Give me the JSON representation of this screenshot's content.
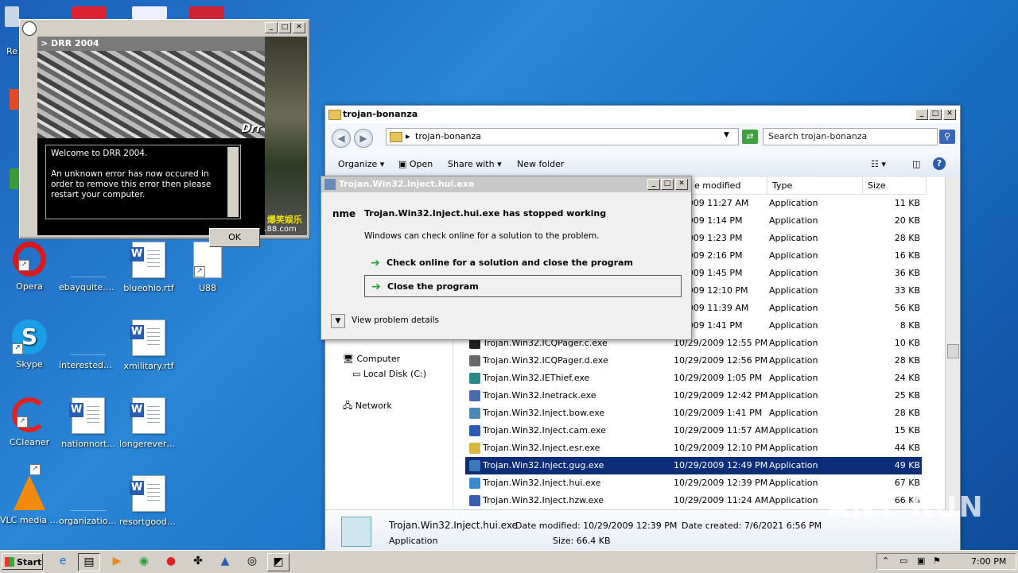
{
  "desktop": {
    "icons": [
      {
        "label": "Opera",
        "kind": "opera"
      },
      {
        "label": "ebayquite.png",
        "kind": "blank"
      },
      {
        "label": "blueohio.rtf",
        "kind": "word"
      },
      {
        "label": "U88",
        "kind": "doc"
      },
      {
        "label": "Skype",
        "kind": "skype"
      },
      {
        "label": "interestedm...",
        "kind": "blank"
      },
      {
        "label": "xmilitary.rtf",
        "kind": "word"
      },
      {
        "label": "CCleaner",
        "kind": "ccleaner"
      },
      {
        "label": "nationnort...",
        "kind": "word"
      },
      {
        "label": "longerevery...",
        "kind": "word"
      },
      {
        "label": "VLC media player",
        "kind": "vlc"
      },
      {
        "label": "organization...",
        "kind": "blank"
      },
      {
        "label": "resortgoods...",
        "kind": "word"
      }
    ],
    "partial_label_re": "Re"
  },
  "drr": {
    "header": "> DRR 2004",
    "logo": "Drr",
    "message_lines": [
      "Welcome to DRR 2004.",
      "An unknown error has now occured in order to remove this error then please restart your computer."
    ],
    "ok_label": "OK",
    "chinese_text": "妖 爆笑娱乐",
    "url_text": "a188.com"
  },
  "explorer": {
    "title": "trojan-bonanza",
    "address": "trojan-bonanza",
    "search_placeholder": "Search trojan-bonanza",
    "toolbar": {
      "organize": "Organize",
      "open": "Open",
      "share_with": "Share with",
      "new_folder": "New folder"
    },
    "nav": {
      "computer": "Computer",
      "local_disk": "Local Disk (C:)",
      "network": "Network"
    },
    "columns": {
      "date": "e modified",
      "type": "Type",
      "size": "Size"
    },
    "rows": [
      {
        "name": "",
        "date": "9/2009 11:27 AM",
        "type": "Application",
        "size": "11 KB"
      },
      {
        "name": "",
        "date": "9/2009 1:14 PM",
        "type": "Application",
        "size": "20 KB"
      },
      {
        "name": "",
        "date": "9/2009 1:23 PM",
        "type": "Application",
        "size": "28 KB"
      },
      {
        "name": "",
        "date": "9/2009 2:16 PM",
        "type": "Application",
        "size": "16 KB"
      },
      {
        "name": "",
        "date": "9/2009 1:45 PM",
        "type": "Application",
        "size": "36 KB"
      },
      {
        "name": "",
        "date": "9/2009 12:10 PM",
        "type": "Application",
        "size": "33 KB"
      },
      {
        "name": "",
        "date": "9/2009 11:39 AM",
        "type": "Application",
        "size": "56 KB"
      },
      {
        "name": "",
        "date": "9/2009 1:41 PM",
        "type": "Application",
        "size": "8 KB"
      },
      {
        "name": "Trojan.Win32.ICQPager.c.exe",
        "date": "10/29/2009 12:55 PM",
        "type": "Application",
        "size": "10 KB"
      },
      {
        "name": "Trojan.Win32.ICQPager.d.exe",
        "date": "10/29/2009 12:56 PM",
        "type": "Application",
        "size": "28 KB"
      },
      {
        "name": "Trojan.Win32.IEThief.exe",
        "date": "10/29/2009 1:05 PM",
        "type": "Application",
        "size": "24 KB"
      },
      {
        "name": "Trojan.Win32.Inetrack.exe",
        "date": "10/29/2009 12:42 PM",
        "type": "Application",
        "size": "25 KB"
      },
      {
        "name": "Trojan.Win32.Inject.bow.exe",
        "date": "10/29/2009 1:41 PM",
        "type": "Application",
        "size": "28 KB"
      },
      {
        "name": "Trojan.Win32.Inject.cam.exe",
        "date": "10/29/2009 11:57 AM",
        "type": "Application",
        "size": "15 KB"
      },
      {
        "name": "Trojan.Win32.Inject.esr.exe",
        "date": "10/29/2009 12:10 PM",
        "type": "Application",
        "size": "44 KB"
      },
      {
        "name": "Trojan.Win32.Inject.gug.exe",
        "date": "10/29/2009 12:49 PM",
        "type": "Application",
        "size": "49 KB",
        "selected": true
      },
      {
        "name": "Trojan.Win32.Inject.hui.exe",
        "date": "10/29/2009 12:39 PM",
        "type": "Application",
        "size": "67 KB"
      },
      {
        "name": "Trojan.Win32.Inject.hzw.exe",
        "date": "10/29/2009 11:24 AM",
        "type": "Application",
        "size": "66 KB"
      }
    ],
    "details": {
      "name": "Trojan.Win32.Inject.hui.exe",
      "modified": "Date modified: 10/29/2009 12:39 PM",
      "created": "Date created: 7/6/2021 6:56 PM",
      "kind": "Application",
      "size": "Size: 66.4 KB"
    }
  },
  "error_dialog": {
    "title": "Trojan.Win32.Inject.hui.exe",
    "icon_text": "nme",
    "heading": "Trojan.Win32.Inject.hui.exe has stopped working",
    "subtext": "Windows can check online for a solution to the problem.",
    "option_check": "Check online for a solution and close the program",
    "option_close": "Close the program",
    "details_label": "View problem details"
  },
  "taskbar": {
    "start_label": "Start",
    "clock": "7:00 PM"
  },
  "watermark": "ANY RUN"
}
